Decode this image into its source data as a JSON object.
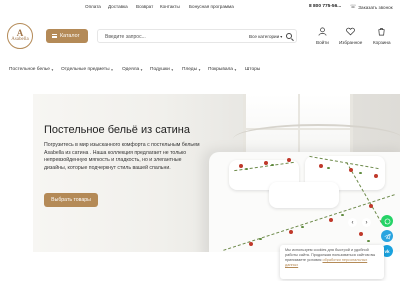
{
  "logo": {
    "mark": "A",
    "brand": "Asabella"
  },
  "topbar": {
    "links": [
      "Оплата",
      "Доставка",
      "Возврат",
      "Контакты",
      "Бонусная программа"
    ],
    "phone": "8 800 775-56...",
    "callback": "Заказать звонок"
  },
  "header": {
    "catalog_label": "Каталог",
    "search_placeholder": "Введите запрос...",
    "search_category": "Все категории",
    "icons": [
      {
        "icon": "user-icon",
        "label": "Войти"
      },
      {
        "icon": "heart-icon",
        "label": "Избранное"
      },
      {
        "icon": "cart-icon",
        "label": "Корзина"
      }
    ]
  },
  "nav": {
    "items": [
      {
        "label": "Постельное белье",
        "has_dropdown": true
      },
      {
        "label": "Отдельные предметы",
        "has_dropdown": true
      },
      {
        "label": "Одеяла",
        "has_dropdown": true
      },
      {
        "label": "Подушки",
        "has_dropdown": true
      },
      {
        "label": "Пледы",
        "has_dropdown": true
      },
      {
        "label": "Покрывала",
        "has_dropdown": true
      },
      {
        "label": "Шторы",
        "has_dropdown": false
      }
    ]
  },
  "hero": {
    "title": "Постельное бельё из сатина",
    "text": "Погрузитесь в мир изысканного комфорта с постельным бельем Asabella из сатина . Наша коллекция предлагает не только непревзойденную мягкость и гладкость, но и элегантные дизайны, которые подчеркнут стиль вашей спальни.",
    "button": "Выбрать товары"
  },
  "slider": {
    "prev": "‹",
    "next": "›"
  },
  "social": [
    {
      "icon": "whatsapp-icon",
      "color": "#25d366"
    },
    {
      "icon": "telegram-icon",
      "color": "#2aa4e0"
    },
    {
      "icon": "vk-icon",
      "color": "#19a2de"
    }
  ],
  "cookie": {
    "text": "Мы используем cookies для быстрой и удобной работы сайта. Продолжая пользоваться сайтом вы принимаете условия",
    "link": "обработки персональных данных"
  },
  "colors": {
    "accent": "#b48a57"
  }
}
